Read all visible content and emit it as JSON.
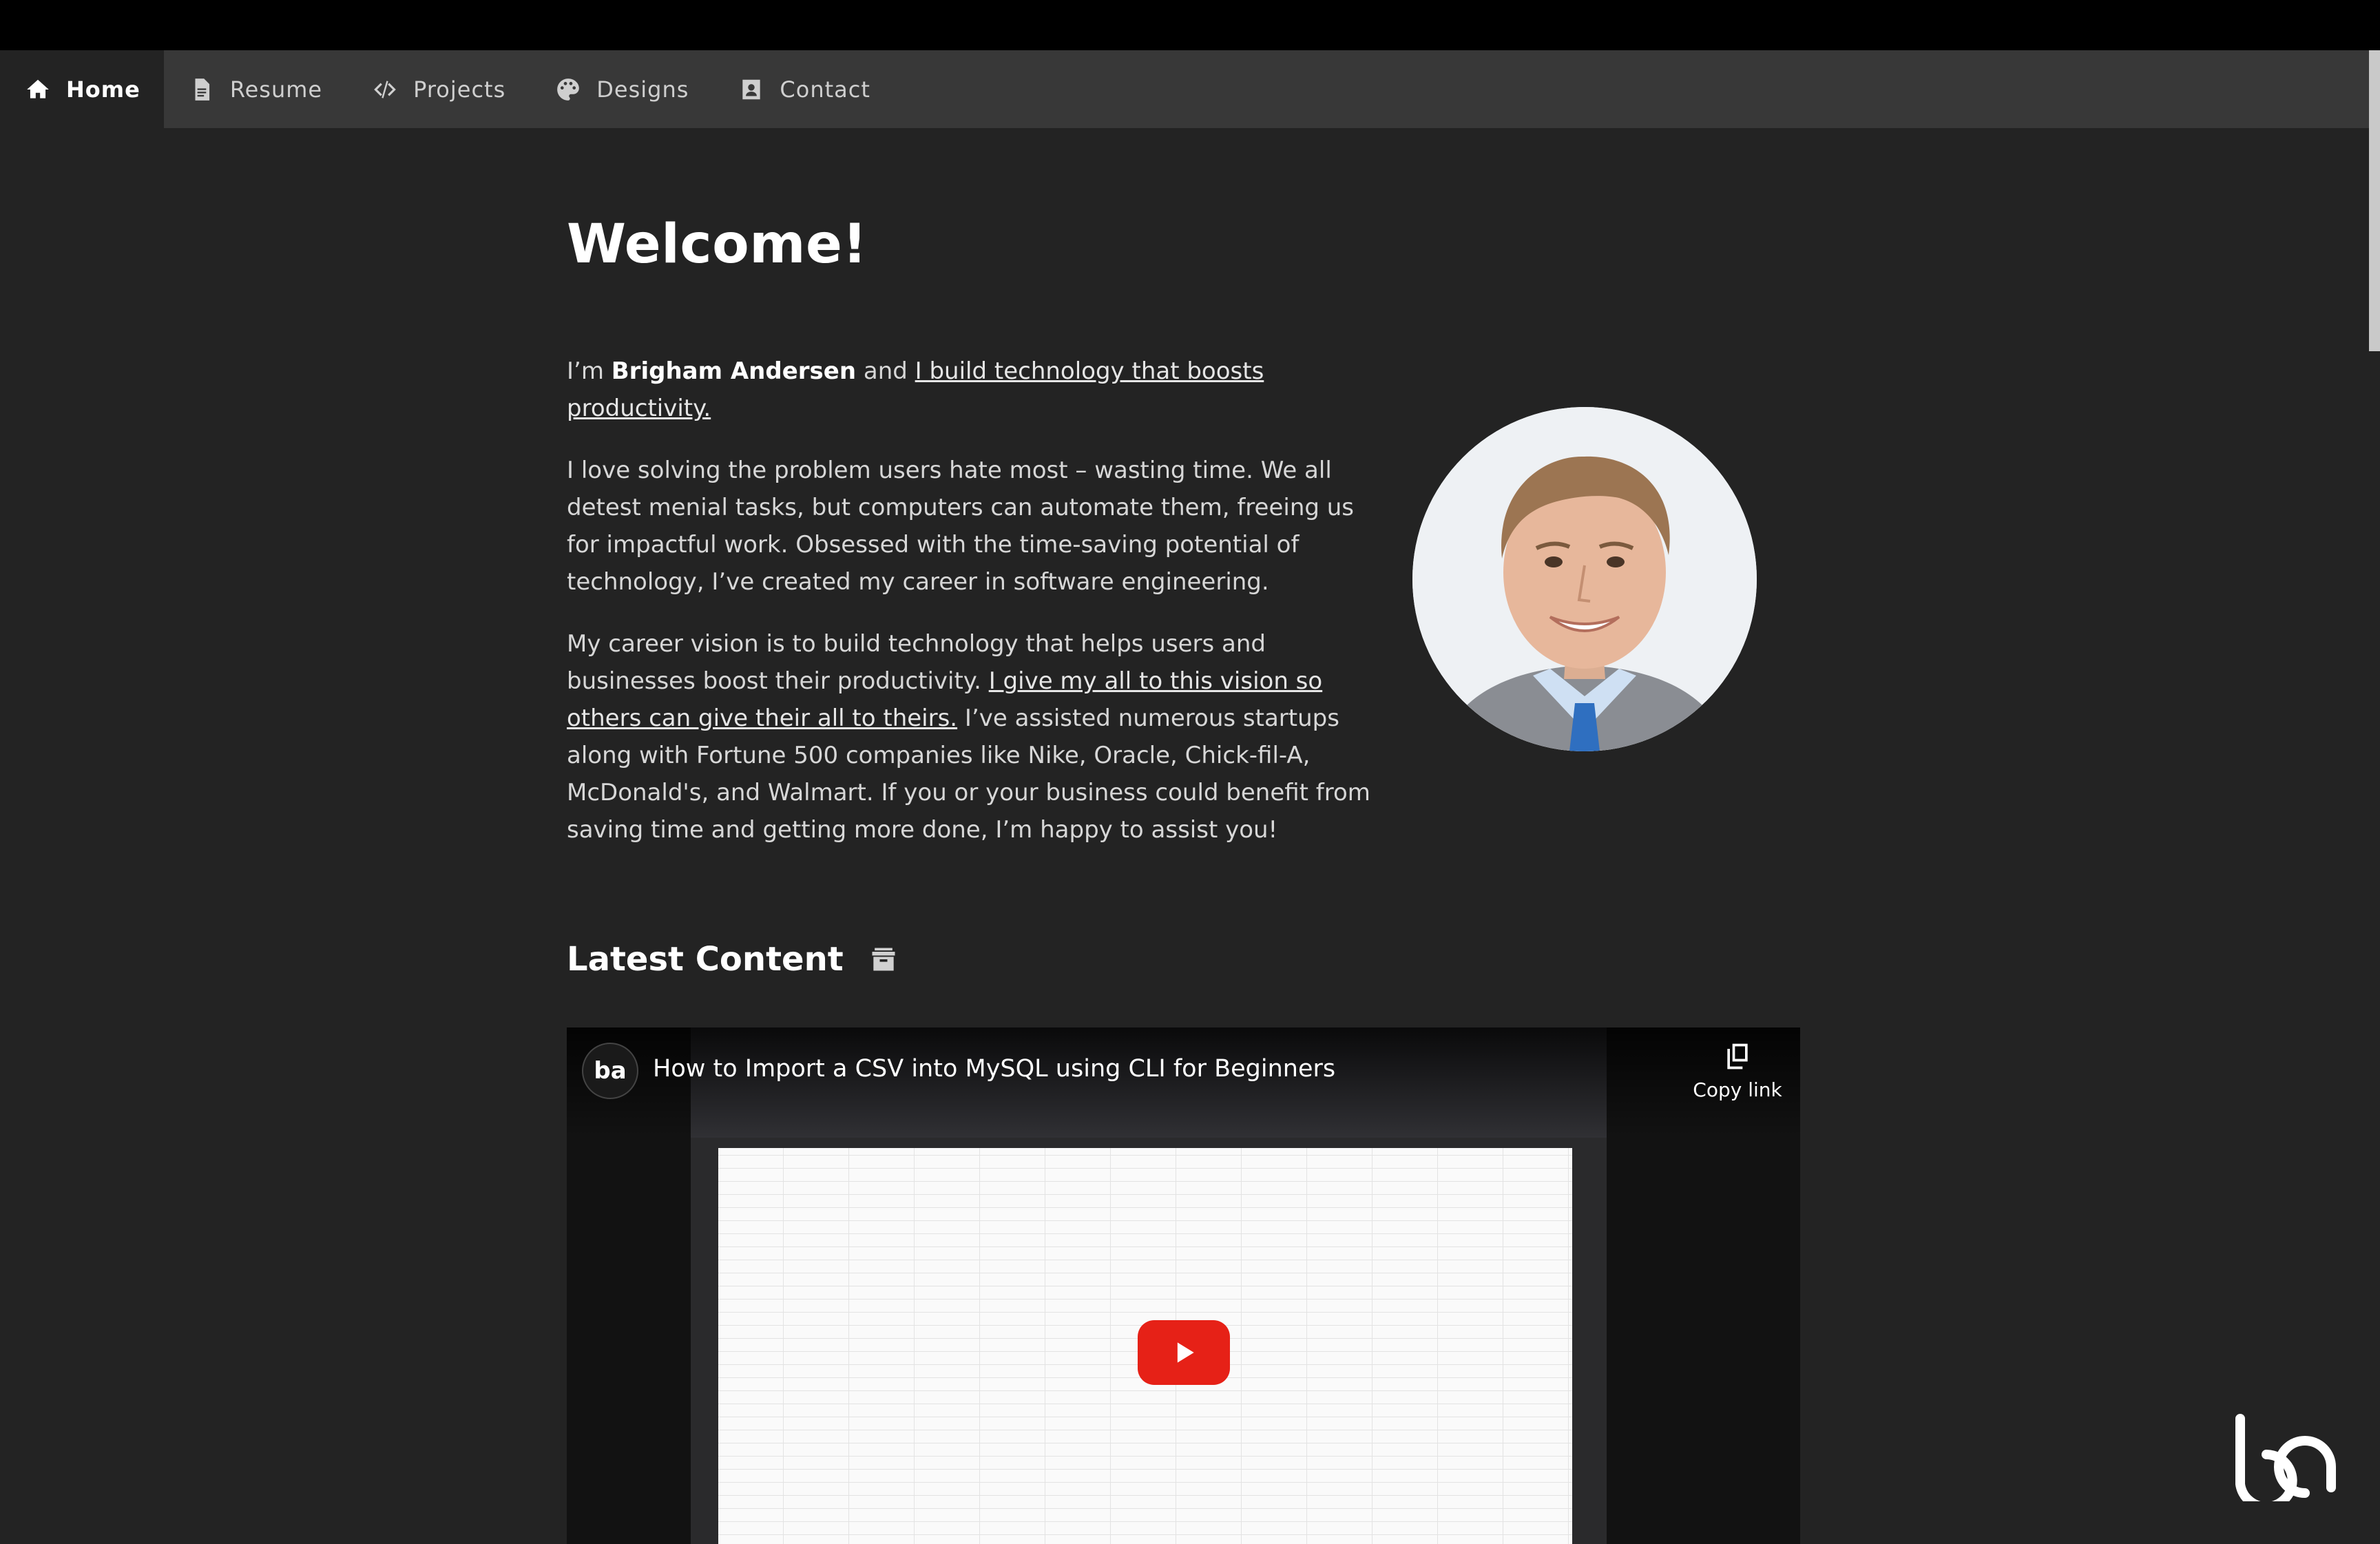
{
  "nav": {
    "items": [
      {
        "label": "Home",
        "icon": "home-icon",
        "active": true
      },
      {
        "label": "Resume",
        "icon": "document-icon",
        "active": false
      },
      {
        "label": "Projects",
        "icon": "code-icon",
        "active": false
      },
      {
        "label": "Designs",
        "icon": "palette-icon",
        "active": false
      },
      {
        "label": "Contact",
        "icon": "contact-card-icon",
        "active": false
      }
    ]
  },
  "main": {
    "heading": "Welcome!",
    "intro": {
      "prefix": "I’m ",
      "name": "Brigham Andersen",
      "middle": " and ",
      "link": "I build technology that boosts productivity."
    },
    "paragraph2": "I love solving the problem users hate most – wasting time. We all detest menial tasks, but computers can automate them, freeing us for impactful work. Obsessed with the time-saving potential of technology, I’ve created my career in software engineering.",
    "paragraph3": {
      "start": "My career vision is to build technology that helps users and businesses boost their productivity. ",
      "link": "I give my all to this vision so others can give their all to theirs.",
      "end": " I’ve assisted numerous startups along with Fortune 500 companies like Nike, Oracle, Chick-fil-A, McDonald's, and Walmart. If you or your business could benefit from saving time and getting more done, I’m happy to assist you!"
    },
    "latest_heading": "Latest Content",
    "latest_icon": "archive-icon"
  },
  "video": {
    "channel_logo": "ba",
    "title": "How to Import a CSV into MySQL using CLI for Beginners",
    "copy_link": "Copy link",
    "play_icon": "play-icon",
    "play_color": "#e62117"
  },
  "colors": {
    "background": "#232323",
    "nav_background": "#383838",
    "top_bar": "#000000"
  }
}
